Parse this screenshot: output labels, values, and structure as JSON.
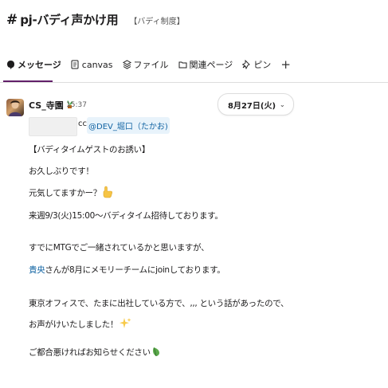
{
  "channel": {
    "hash": "#",
    "name": "pj-バディ声かけ用",
    "topic": "【バディ制度】"
  },
  "tabs": [
    {
      "label": "メッセージ",
      "icon": "message-icon"
    },
    {
      "label": "canvas",
      "icon": "canvas-icon"
    },
    {
      "label": "ファイル",
      "icon": "files-icon"
    },
    {
      "label": "関連ページ",
      "icon": "folder-icon"
    },
    {
      "label": "ピン",
      "icon": "pin-icon"
    },
    {
      "label": "+",
      "icon": "plus-icon"
    }
  ],
  "message": {
    "sender": "CS_寺園",
    "time": "15:37",
    "date_pill": "8月27日(火)",
    "cc_prefix": "cc:",
    "mention": "@DEV_堀口（たかお)",
    "lines": {
      "l1": "【バディタイムゲストのお誘い】",
      "l2": "お久しぶりです！",
      "l3": "元気してますかー？",
      "l4": "来週9/3(火)15:00〜バディタイム招待しております。",
      "l5": "すでにMTGでご一緒されているかと思いますが、",
      "l6_link": "貴央",
      "l6_rest": "さんが8月にメモリーチームにjoinしております。",
      "l7": "東京オフィスで、たまに出社している方で、,,, という話があったので、",
      "l8": "お声がけいたしました！",
      "l9": "ご都合悪ければお知らせください"
    }
  },
  "colors": {
    "accent": "#611f69",
    "link": "#1264a3",
    "mention_bg": "#e8f3fb"
  }
}
